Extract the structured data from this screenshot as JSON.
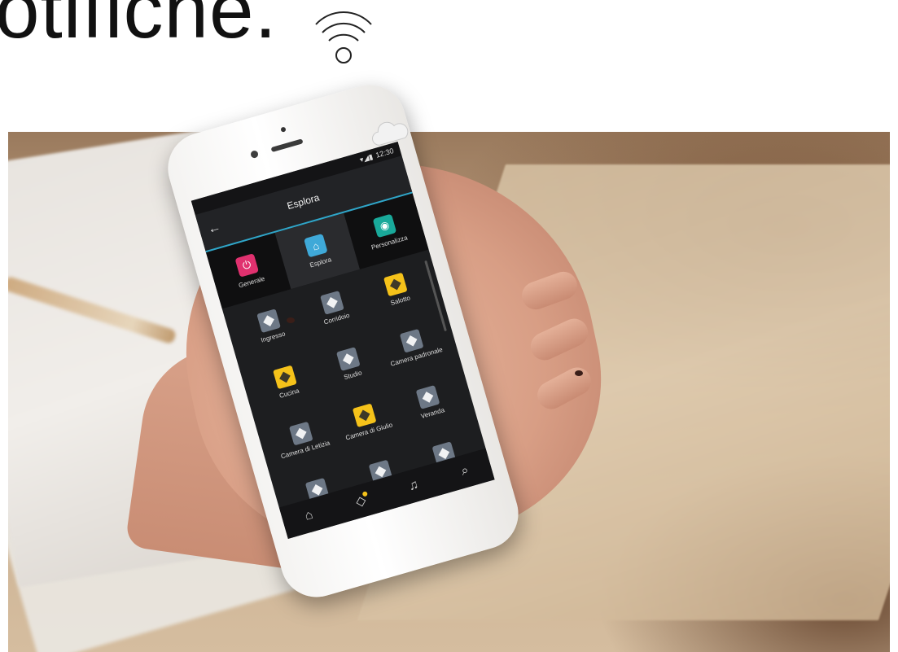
{
  "headline": "otifiche.",
  "app": {
    "title": "Esplora",
    "status_time": "12:30",
    "modes": [
      {
        "label": "Generale",
        "color": "#e0316f",
        "icon": "power-icon"
      },
      {
        "label": "Esplora",
        "color": "#3fa9d8",
        "icon": "home-icon"
      },
      {
        "label": "Personalizza",
        "color": "#19a99a",
        "icon": "gear-icon"
      }
    ],
    "rooms": [
      {
        "label": "Ingresso",
        "color": "#6d7886"
      },
      {
        "label": "Corridoio",
        "color": "#6d7886"
      },
      {
        "label": "Salotto",
        "color": "#f5c21a"
      },
      {
        "label": "Cucina",
        "color": "#f5c21a"
      },
      {
        "label": "Studio",
        "color": "#6d7886"
      },
      {
        "label": "Camera padronale",
        "color": "#6d7886"
      },
      {
        "label": "Camera di Letizia",
        "color": "#6d7886"
      },
      {
        "label": "Camera di Giulio",
        "color": "#f5c21a"
      },
      {
        "label": "Veranda",
        "color": "#6d7886"
      },
      {
        "label": "",
        "color": "#6d7886"
      },
      {
        "label": "",
        "color": "#6d7886"
      },
      {
        "label": "",
        "color": "#6d7886"
      }
    ],
    "nav": [
      "home-icon",
      "chat-icon",
      "bell-icon",
      "search-icon"
    ]
  }
}
